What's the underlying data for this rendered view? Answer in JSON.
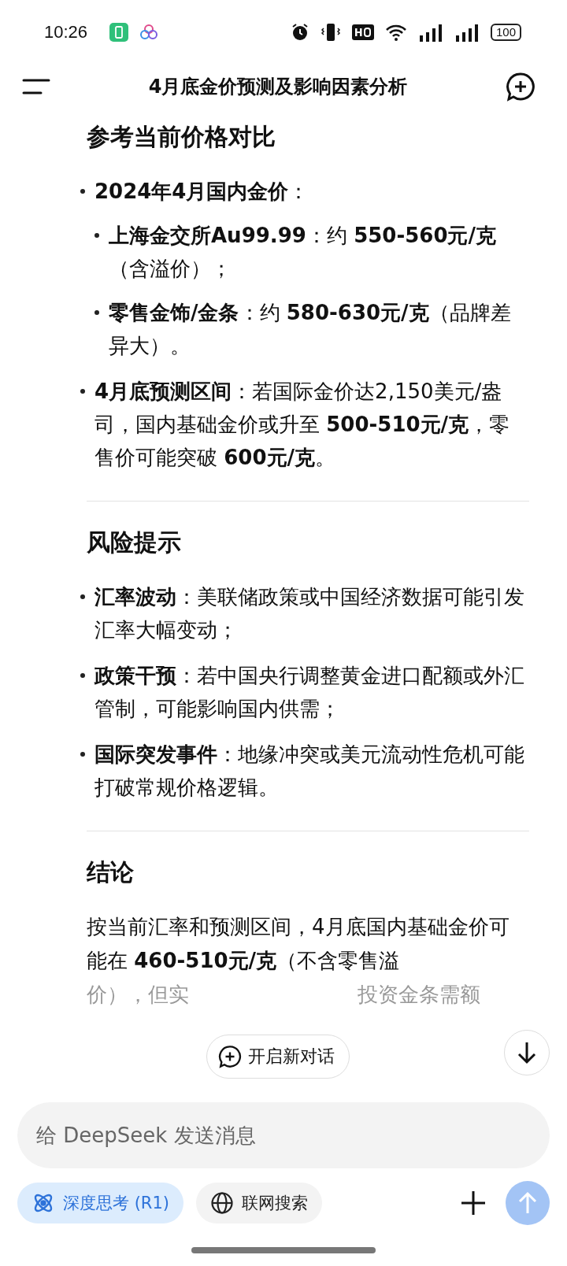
{
  "status_bar": {
    "time": "10:26",
    "battery": "100"
  },
  "header": {
    "title": "4月底金价预测及影响因素分析"
  },
  "sections": [
    {
      "heading": "参考当前价格对比",
      "items": [
        {
          "text": "**2024年4月国内金价**：",
          "children": [
            {
              "text": "**上海金交所Au99.99**：约 **550-560元/克**（含溢价）；"
            },
            {
              "text": "**零售金饰/金条**：约 **580-630元/克**（品牌差异大）。"
            }
          ]
        },
        {
          "text": "**4月底预测区间**：若国际金价达2,150美元/盎司，国内基础金价或升至 **500-510元/克**，零售价可能突破 **600元/克**。"
        }
      ]
    },
    {
      "heading": "风险提示",
      "items": [
        {
          "text": "**汇率波动**：美联储政策或中国经济数据可能引发汇率大幅变动；"
        },
        {
          "text": "**政策干预**：若中国央行调整黄金进口配额或外汇管制，可能影响国内供需；"
        },
        {
          "text": "**国际突发事件**：地缘冲突或美元流动性危机可能打破常规价格逻辑。"
        }
      ]
    },
    {
      "heading": "结论",
      "paragraph": "按当前汇率和预测区间，4月底国内基础金价可能在 **460-510元/克**（不含零售溢",
      "faded_line": [
        "价），但实",
        "投资金条需额"
      ]
    }
  ],
  "new_chat_button": "开启新对话",
  "composer": {
    "placeholder": "给 DeepSeek 发送消息",
    "chips": [
      {
        "label": "深度思考 (R1)",
        "selected": true,
        "kind": "think"
      },
      {
        "label": "联网搜索",
        "selected": false,
        "kind": "web"
      }
    ]
  }
}
